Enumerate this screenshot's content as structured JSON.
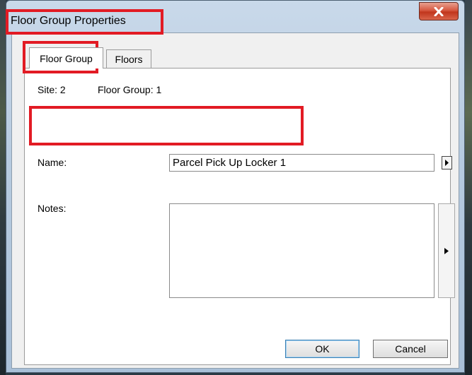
{
  "window": {
    "title": "Floor Group Properties"
  },
  "tabs": [
    {
      "label": "Floor Group",
      "active": true
    },
    {
      "label": "Floors",
      "active": false
    }
  ],
  "info": {
    "site": "Site: 2",
    "floor_group": "Floor Group: 1"
  },
  "form": {
    "name_label": "Name:",
    "name_value": "Parcel Pick Up Locker 1",
    "notes_label": "Notes:",
    "notes_value": ""
  },
  "buttons": {
    "ok": "OK",
    "cancel": "Cancel"
  },
  "colors": {
    "highlight": "#e21b24",
    "close_button": "#c1361d"
  },
  "icons": {
    "close": "close-icon",
    "arrow": "play-arrow-icon"
  }
}
